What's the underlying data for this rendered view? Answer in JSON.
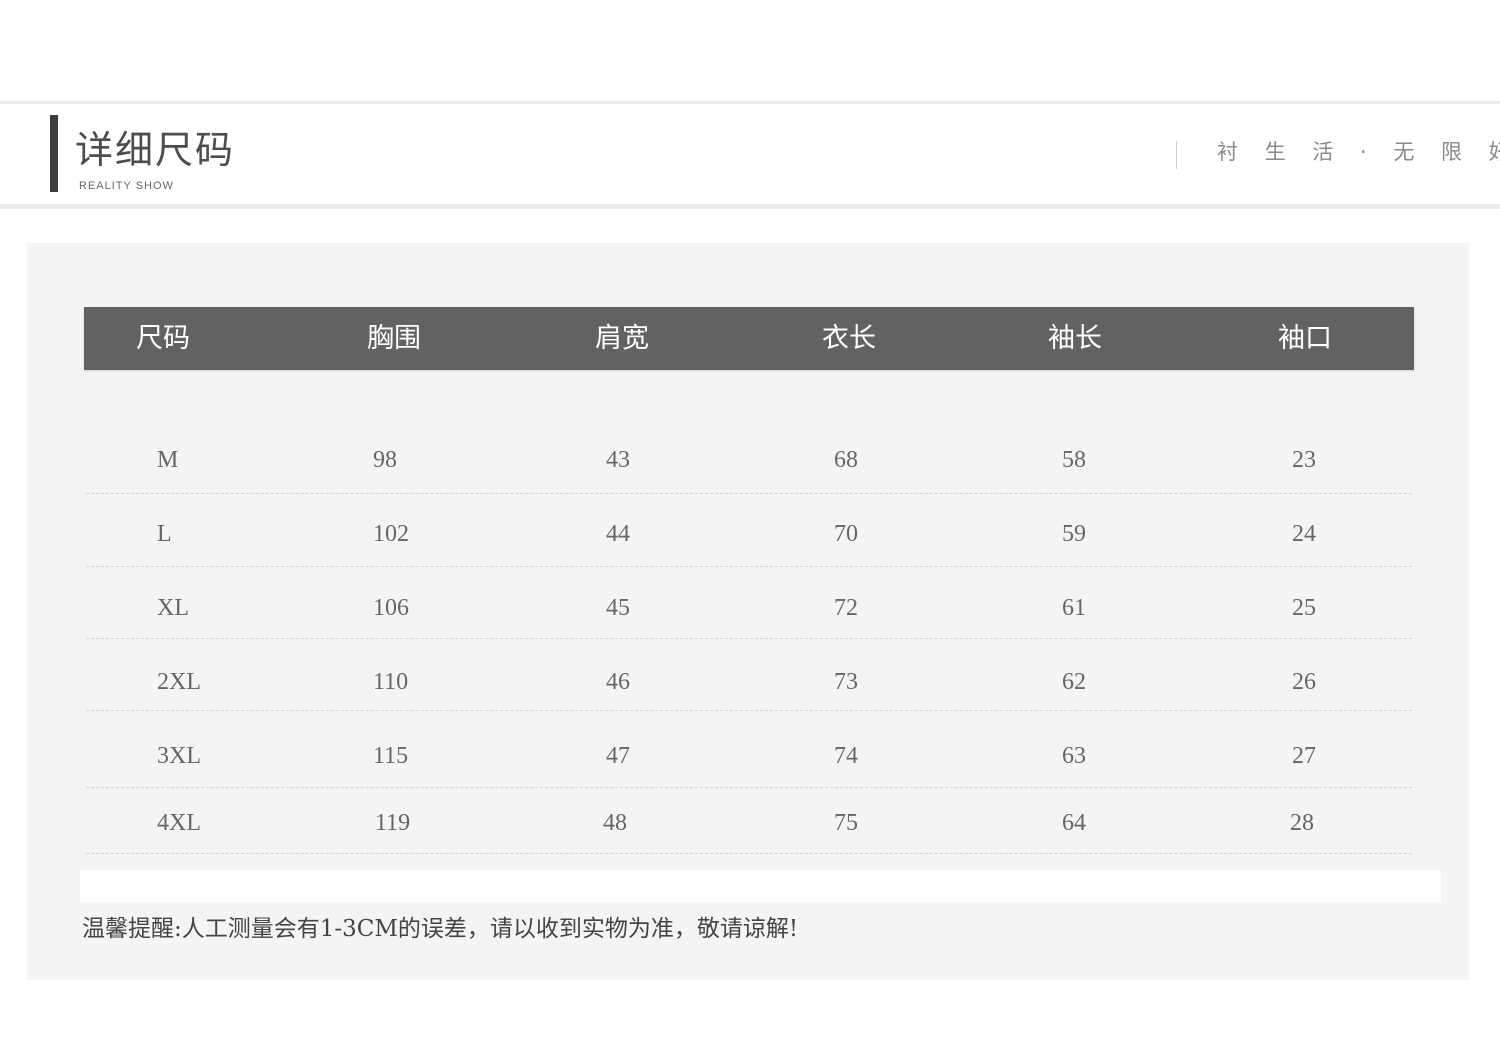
{
  "header": {
    "title": "详细尺码",
    "subtitle": "REALITY SHOW",
    "slogan": "衬 生 活 · 无 限 好"
  },
  "table": {
    "columns": [
      "尺码",
      "胸围",
      "肩宽",
      "衣长",
      "袖长",
      "袖口"
    ],
    "rows": [
      [
        "M",
        "98",
        "43",
        "68",
        "58",
        "23"
      ],
      [
        "L",
        "102",
        "44",
        "70",
        "59",
        "24"
      ],
      [
        "XL",
        "106",
        "45",
        "72",
        "61",
        "25"
      ],
      [
        "2XL",
        "110",
        "46",
        "73",
        "62",
        "26"
      ],
      [
        "3XL",
        "115",
        "47",
        "74",
        "63",
        "27"
      ],
      [
        "4XL",
        "119",
        "48",
        "75",
        "64",
        "28"
      ]
    ]
  },
  "note": "温馨提醒:人工测量会有1-3CM的误差，请以收到实物为准，敬请谅解!"
}
